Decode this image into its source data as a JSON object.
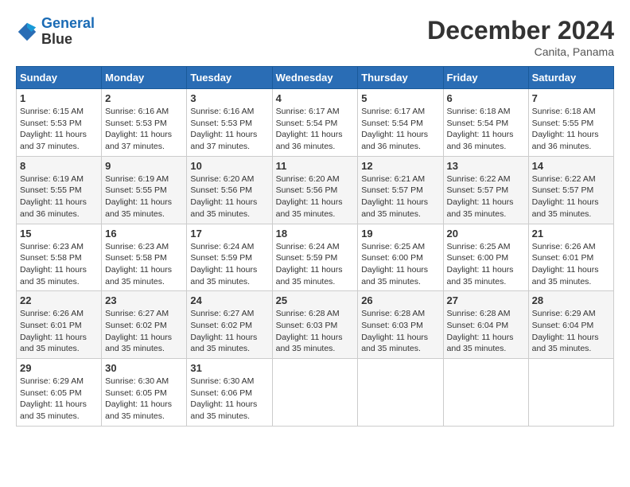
{
  "header": {
    "logo_line1": "General",
    "logo_line2": "Blue",
    "month_title": "December 2024",
    "subtitle": "Canita, Panama"
  },
  "weekdays": [
    "Sunday",
    "Monday",
    "Tuesday",
    "Wednesday",
    "Thursday",
    "Friday",
    "Saturday"
  ],
  "weeks": [
    [
      {
        "day": "1",
        "sunrise": "6:15 AM",
        "sunset": "5:53 PM",
        "daylight": "11 hours and 37 minutes."
      },
      {
        "day": "2",
        "sunrise": "6:16 AM",
        "sunset": "5:53 PM",
        "daylight": "11 hours and 37 minutes."
      },
      {
        "day": "3",
        "sunrise": "6:16 AM",
        "sunset": "5:53 PM",
        "daylight": "11 hours and 37 minutes."
      },
      {
        "day": "4",
        "sunrise": "6:17 AM",
        "sunset": "5:54 PM",
        "daylight": "11 hours and 36 minutes."
      },
      {
        "day": "5",
        "sunrise": "6:17 AM",
        "sunset": "5:54 PM",
        "daylight": "11 hours and 36 minutes."
      },
      {
        "day": "6",
        "sunrise": "6:18 AM",
        "sunset": "5:54 PM",
        "daylight": "11 hours and 36 minutes."
      },
      {
        "day": "7",
        "sunrise": "6:18 AM",
        "sunset": "5:55 PM",
        "daylight": "11 hours and 36 minutes."
      }
    ],
    [
      {
        "day": "8",
        "sunrise": "6:19 AM",
        "sunset": "5:55 PM",
        "daylight": "11 hours and 36 minutes."
      },
      {
        "day": "9",
        "sunrise": "6:19 AM",
        "sunset": "5:55 PM",
        "daylight": "11 hours and 35 minutes."
      },
      {
        "day": "10",
        "sunrise": "6:20 AM",
        "sunset": "5:56 PM",
        "daylight": "11 hours and 35 minutes."
      },
      {
        "day": "11",
        "sunrise": "6:20 AM",
        "sunset": "5:56 PM",
        "daylight": "11 hours and 35 minutes."
      },
      {
        "day": "12",
        "sunrise": "6:21 AM",
        "sunset": "5:57 PM",
        "daylight": "11 hours and 35 minutes."
      },
      {
        "day": "13",
        "sunrise": "6:22 AM",
        "sunset": "5:57 PM",
        "daylight": "11 hours and 35 minutes."
      },
      {
        "day": "14",
        "sunrise": "6:22 AM",
        "sunset": "5:57 PM",
        "daylight": "11 hours and 35 minutes."
      }
    ],
    [
      {
        "day": "15",
        "sunrise": "6:23 AM",
        "sunset": "5:58 PM",
        "daylight": "11 hours and 35 minutes."
      },
      {
        "day": "16",
        "sunrise": "6:23 AM",
        "sunset": "5:58 PM",
        "daylight": "11 hours and 35 minutes."
      },
      {
        "day": "17",
        "sunrise": "6:24 AM",
        "sunset": "5:59 PM",
        "daylight": "11 hours and 35 minutes."
      },
      {
        "day": "18",
        "sunrise": "6:24 AM",
        "sunset": "5:59 PM",
        "daylight": "11 hours and 35 minutes."
      },
      {
        "day": "19",
        "sunrise": "6:25 AM",
        "sunset": "6:00 PM",
        "daylight": "11 hours and 35 minutes."
      },
      {
        "day": "20",
        "sunrise": "6:25 AM",
        "sunset": "6:00 PM",
        "daylight": "11 hours and 35 minutes."
      },
      {
        "day": "21",
        "sunrise": "6:26 AM",
        "sunset": "6:01 PM",
        "daylight": "11 hours and 35 minutes."
      }
    ],
    [
      {
        "day": "22",
        "sunrise": "6:26 AM",
        "sunset": "6:01 PM",
        "daylight": "11 hours and 35 minutes."
      },
      {
        "day": "23",
        "sunrise": "6:27 AM",
        "sunset": "6:02 PM",
        "daylight": "11 hours and 35 minutes."
      },
      {
        "day": "24",
        "sunrise": "6:27 AM",
        "sunset": "6:02 PM",
        "daylight": "11 hours and 35 minutes."
      },
      {
        "day": "25",
        "sunrise": "6:28 AM",
        "sunset": "6:03 PM",
        "daylight": "11 hours and 35 minutes."
      },
      {
        "day": "26",
        "sunrise": "6:28 AM",
        "sunset": "6:03 PM",
        "daylight": "11 hours and 35 minutes."
      },
      {
        "day": "27",
        "sunrise": "6:28 AM",
        "sunset": "6:04 PM",
        "daylight": "11 hours and 35 minutes."
      },
      {
        "day": "28",
        "sunrise": "6:29 AM",
        "sunset": "6:04 PM",
        "daylight": "11 hours and 35 minutes."
      }
    ],
    [
      {
        "day": "29",
        "sunrise": "6:29 AM",
        "sunset": "6:05 PM",
        "daylight": "11 hours and 35 minutes."
      },
      {
        "day": "30",
        "sunrise": "6:30 AM",
        "sunset": "6:05 PM",
        "daylight": "11 hours and 35 minutes."
      },
      {
        "day": "31",
        "sunrise": "6:30 AM",
        "sunset": "6:06 PM",
        "daylight": "11 hours and 35 minutes."
      },
      null,
      null,
      null,
      null
    ]
  ]
}
